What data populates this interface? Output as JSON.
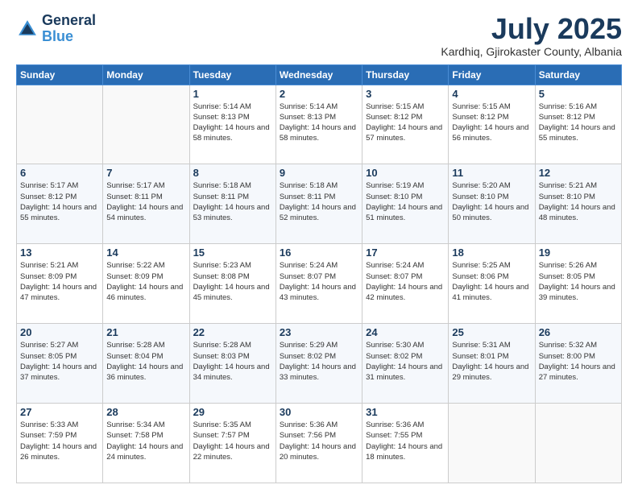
{
  "header": {
    "logo_line1": "General",
    "logo_line2": "Blue",
    "month": "July 2025",
    "location": "Kardhiq, Gjirokaster County, Albania"
  },
  "weekdays": [
    "Sunday",
    "Monday",
    "Tuesday",
    "Wednesday",
    "Thursday",
    "Friday",
    "Saturday"
  ],
  "weeks": [
    [
      {
        "day": "",
        "info": ""
      },
      {
        "day": "",
        "info": ""
      },
      {
        "day": "1",
        "info": "Sunrise: 5:14 AM\nSunset: 8:13 PM\nDaylight: 14 hours and 58 minutes."
      },
      {
        "day": "2",
        "info": "Sunrise: 5:14 AM\nSunset: 8:13 PM\nDaylight: 14 hours and 58 minutes."
      },
      {
        "day": "3",
        "info": "Sunrise: 5:15 AM\nSunset: 8:12 PM\nDaylight: 14 hours and 57 minutes."
      },
      {
        "day": "4",
        "info": "Sunrise: 5:15 AM\nSunset: 8:12 PM\nDaylight: 14 hours and 56 minutes."
      },
      {
        "day": "5",
        "info": "Sunrise: 5:16 AM\nSunset: 8:12 PM\nDaylight: 14 hours and 55 minutes."
      }
    ],
    [
      {
        "day": "6",
        "info": "Sunrise: 5:17 AM\nSunset: 8:12 PM\nDaylight: 14 hours and 55 minutes."
      },
      {
        "day": "7",
        "info": "Sunrise: 5:17 AM\nSunset: 8:11 PM\nDaylight: 14 hours and 54 minutes."
      },
      {
        "day": "8",
        "info": "Sunrise: 5:18 AM\nSunset: 8:11 PM\nDaylight: 14 hours and 53 minutes."
      },
      {
        "day": "9",
        "info": "Sunrise: 5:18 AM\nSunset: 8:11 PM\nDaylight: 14 hours and 52 minutes."
      },
      {
        "day": "10",
        "info": "Sunrise: 5:19 AM\nSunset: 8:10 PM\nDaylight: 14 hours and 51 minutes."
      },
      {
        "day": "11",
        "info": "Sunrise: 5:20 AM\nSunset: 8:10 PM\nDaylight: 14 hours and 50 minutes."
      },
      {
        "day": "12",
        "info": "Sunrise: 5:21 AM\nSunset: 8:10 PM\nDaylight: 14 hours and 48 minutes."
      }
    ],
    [
      {
        "day": "13",
        "info": "Sunrise: 5:21 AM\nSunset: 8:09 PM\nDaylight: 14 hours and 47 minutes."
      },
      {
        "day": "14",
        "info": "Sunrise: 5:22 AM\nSunset: 8:09 PM\nDaylight: 14 hours and 46 minutes."
      },
      {
        "day": "15",
        "info": "Sunrise: 5:23 AM\nSunset: 8:08 PM\nDaylight: 14 hours and 45 minutes."
      },
      {
        "day": "16",
        "info": "Sunrise: 5:24 AM\nSunset: 8:07 PM\nDaylight: 14 hours and 43 minutes."
      },
      {
        "day": "17",
        "info": "Sunrise: 5:24 AM\nSunset: 8:07 PM\nDaylight: 14 hours and 42 minutes."
      },
      {
        "day": "18",
        "info": "Sunrise: 5:25 AM\nSunset: 8:06 PM\nDaylight: 14 hours and 41 minutes."
      },
      {
        "day": "19",
        "info": "Sunrise: 5:26 AM\nSunset: 8:05 PM\nDaylight: 14 hours and 39 minutes."
      }
    ],
    [
      {
        "day": "20",
        "info": "Sunrise: 5:27 AM\nSunset: 8:05 PM\nDaylight: 14 hours and 37 minutes."
      },
      {
        "day": "21",
        "info": "Sunrise: 5:28 AM\nSunset: 8:04 PM\nDaylight: 14 hours and 36 minutes."
      },
      {
        "day": "22",
        "info": "Sunrise: 5:28 AM\nSunset: 8:03 PM\nDaylight: 14 hours and 34 minutes."
      },
      {
        "day": "23",
        "info": "Sunrise: 5:29 AM\nSunset: 8:02 PM\nDaylight: 14 hours and 33 minutes."
      },
      {
        "day": "24",
        "info": "Sunrise: 5:30 AM\nSunset: 8:02 PM\nDaylight: 14 hours and 31 minutes."
      },
      {
        "day": "25",
        "info": "Sunrise: 5:31 AM\nSunset: 8:01 PM\nDaylight: 14 hours and 29 minutes."
      },
      {
        "day": "26",
        "info": "Sunrise: 5:32 AM\nSunset: 8:00 PM\nDaylight: 14 hours and 27 minutes."
      }
    ],
    [
      {
        "day": "27",
        "info": "Sunrise: 5:33 AM\nSunset: 7:59 PM\nDaylight: 14 hours and 26 minutes."
      },
      {
        "day": "28",
        "info": "Sunrise: 5:34 AM\nSunset: 7:58 PM\nDaylight: 14 hours and 24 minutes."
      },
      {
        "day": "29",
        "info": "Sunrise: 5:35 AM\nSunset: 7:57 PM\nDaylight: 14 hours and 22 minutes."
      },
      {
        "day": "30",
        "info": "Sunrise: 5:36 AM\nSunset: 7:56 PM\nDaylight: 14 hours and 20 minutes."
      },
      {
        "day": "31",
        "info": "Sunrise: 5:36 AM\nSunset: 7:55 PM\nDaylight: 14 hours and 18 minutes."
      },
      {
        "day": "",
        "info": ""
      },
      {
        "day": "",
        "info": ""
      }
    ]
  ]
}
